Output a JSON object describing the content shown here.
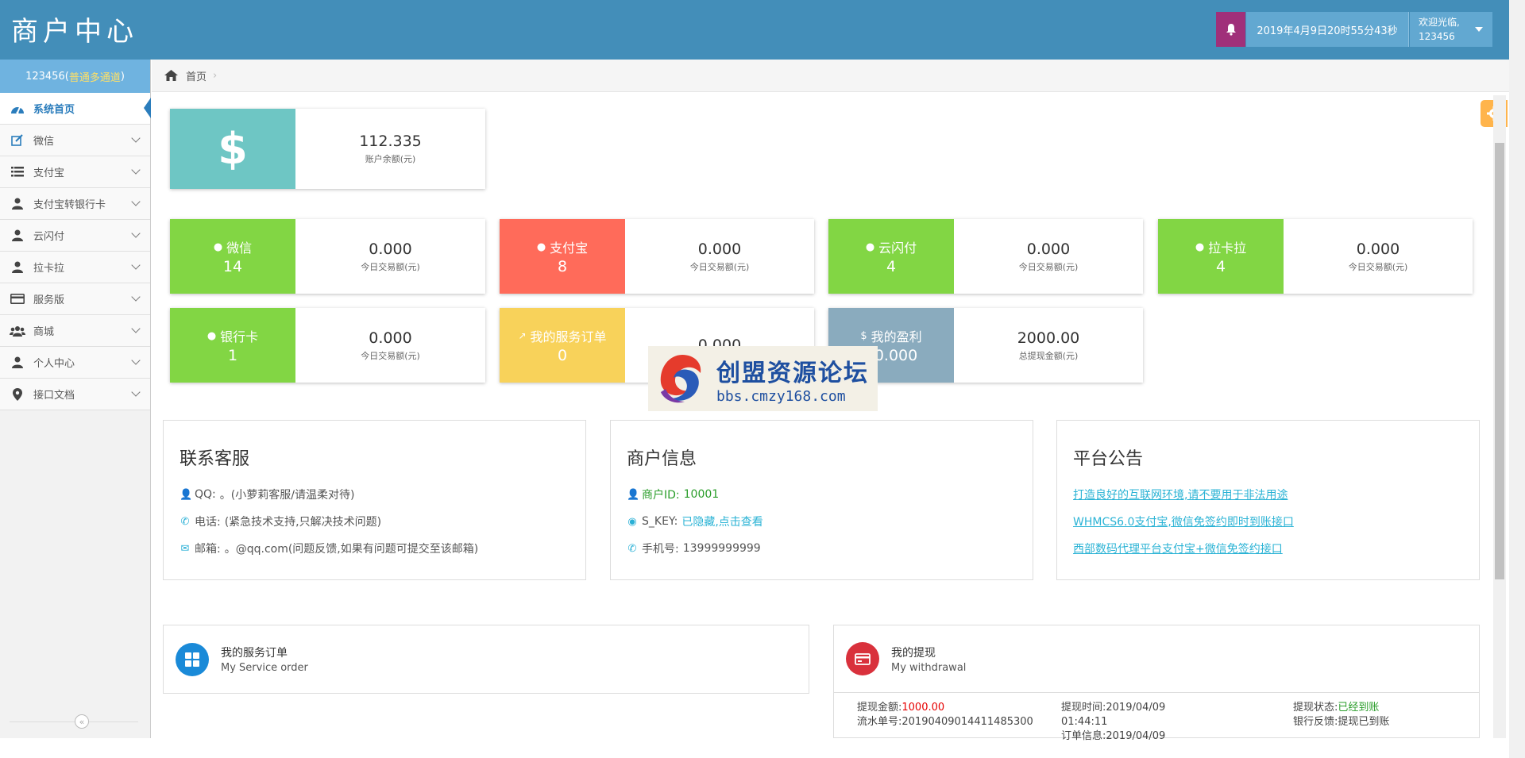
{
  "header": {
    "brand": "商户中心",
    "datetime": "2019年4月9日20时55分43秒",
    "welcome": "欢迎光临,",
    "username": "123456"
  },
  "sidebar": {
    "user_id": "123456",
    "user_open": " ( ",
    "user_level": "普通多通道",
    "user_close": " )",
    "items": [
      {
        "label": "系统首页",
        "icon": "dashboard-icon"
      },
      {
        "label": "微信",
        "icon": "edit-icon"
      },
      {
        "label": "支付宝",
        "icon": "list-icon"
      },
      {
        "label": "支付宝转银行卡",
        "icon": "user-icon"
      },
      {
        "label": "云闪付",
        "icon": "user-icon"
      },
      {
        "label": "拉卡拉",
        "icon": "user-icon"
      },
      {
        "label": "服务版",
        "icon": "credit-card-icon"
      },
      {
        "label": "商城",
        "icon": "users-icon"
      },
      {
        "label": "个人中心",
        "icon": "user-icon"
      },
      {
        "label": "接口文档",
        "icon": "map-marker-icon"
      }
    ],
    "collapse_glyph": "«"
  },
  "breadcrumb": {
    "home": "首页",
    "sep": "›"
  },
  "balance": {
    "symbol": "$",
    "value": "112.335",
    "label": "账户余额(元)"
  },
  "stats": [
    {
      "name": "微信",
      "count": "14",
      "value": "0.000",
      "label": "今日交易额(元)",
      "color": "#82d644"
    },
    {
      "name": "支付宝",
      "count": "8",
      "value": "0.000",
      "label": "今日交易额(元)",
      "color": "#ff6b5a"
    },
    {
      "name": "云闪付",
      "count": "4",
      "value": "0.000",
      "label": "今日交易额(元)",
      "color": "#82d644"
    },
    {
      "name": "拉卡拉",
      "count": "4",
      "value": "0.000",
      "label": "今日交易额(元)",
      "color": "#82d644"
    },
    {
      "name": "银行卡",
      "count": "1",
      "value": "0.000",
      "label": "今日交易额(元)",
      "color": "#82d644"
    },
    {
      "name": "我的服务订单",
      "count": "0",
      "value": "0.000",
      "label": "",
      "color": "#f8d25a"
    },
    {
      "name": "我的盈利",
      "count": "00.000",
      "value": "2000.00",
      "label": "总提现金额(元)",
      "color": "#8aabbe"
    }
  ],
  "contact": {
    "title": "联系客服",
    "qq_label": "QQ:",
    "qq_value": "。(小萝莉客服/请温柔对待)",
    "phone_label": "电话:",
    "phone_value": "(紧急技术支持,只解决技术问题)",
    "email_label": "邮箱:",
    "email_value": "。@qq.com(问题反馈,如果有问题可提交至该邮箱)"
  },
  "merchant": {
    "title": "商户信息",
    "id_label": "商户ID:",
    "id_value": "10001",
    "skey_label": "S_KEY:",
    "skey_value": "已隐藏,点击查看",
    "phone_label": "手机号:",
    "phone_value": "13999999999"
  },
  "notice": {
    "title": "平台公告",
    "links": [
      "打造良好的互联网环境,请不要用于非法用途",
      "WHMCS6.0支付宝,微信免签约即时到账接口",
      "西部数码代理平台支付宝+微信免签约接口"
    ]
  },
  "service_order": {
    "title": "我的服务订单",
    "subtitle": "My Service order",
    "color": "#1a8ad8"
  },
  "withdrawal": {
    "title": "我的提现",
    "subtitle": "My withdrawal",
    "color": "#d9313c",
    "amount_label": "提现金额:",
    "amount_value": "1000.00",
    "serial_label": "流水单号:",
    "serial_value": "20190409014411485300",
    "time_label": "提现时间:",
    "time_value": "2019/04/09",
    "time_value2": "01:44:11",
    "order_label": "订单信息:",
    "order_value": "2019/04/09",
    "status_label": "提现状态:",
    "status_value": "已经到账",
    "feedback_label": "银行反馈:",
    "feedback_value": "提现已到账"
  },
  "watermark": {
    "title": "创盟资源论坛",
    "url": "bbs.cmzy168.com"
  }
}
